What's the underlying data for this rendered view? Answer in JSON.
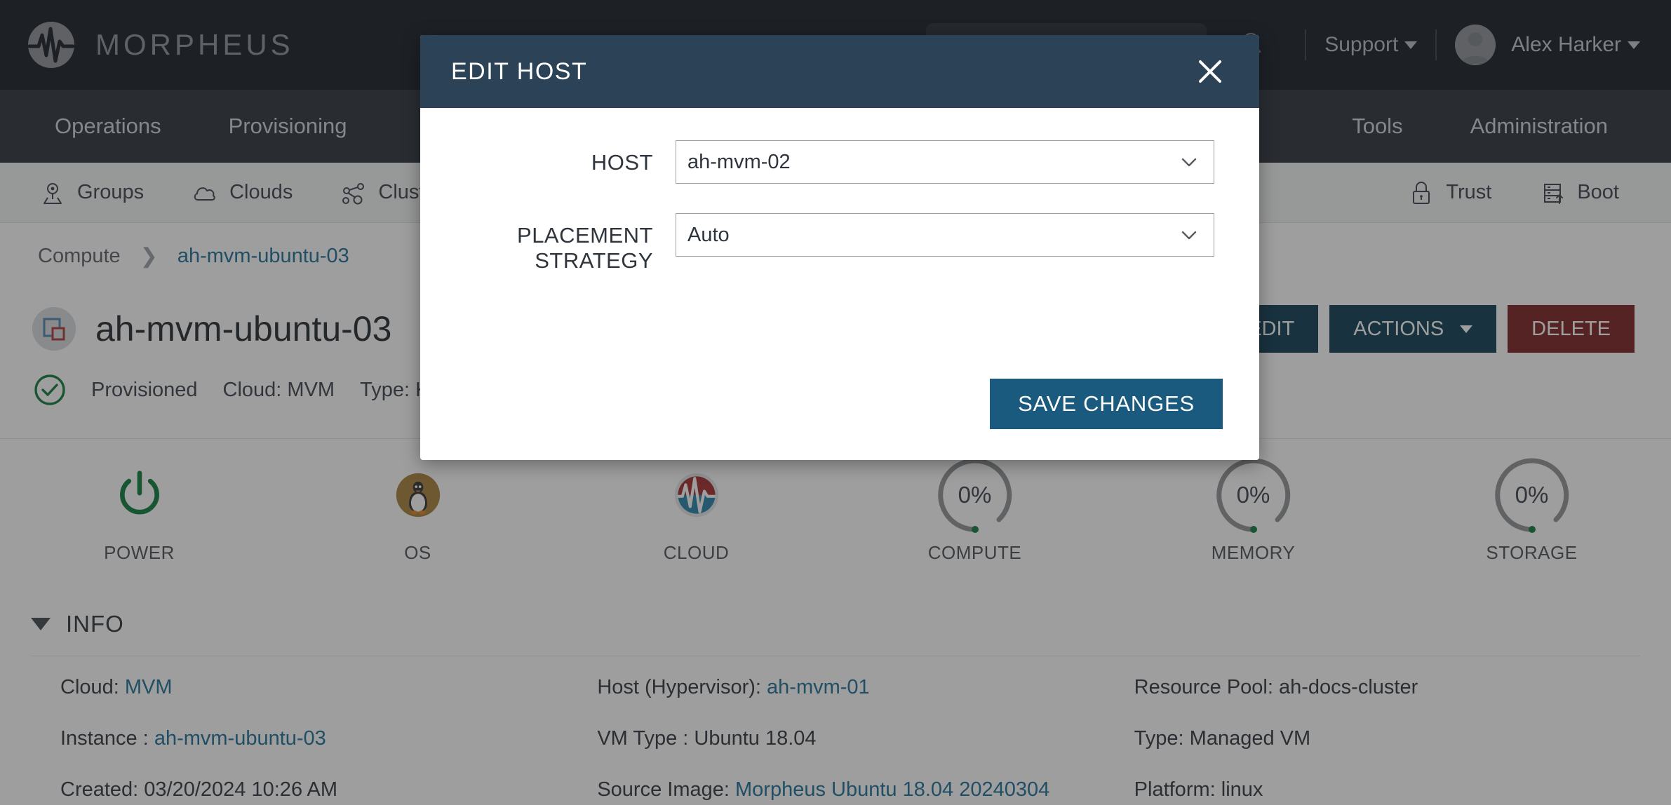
{
  "header": {
    "brand_name": "MORPHEUS",
    "logo_icon": "morpheus-waveform-logo",
    "search_placeholder": "",
    "search_icon": "search-icon",
    "bell_icon": "notification-bell-icon",
    "support_label": "Support",
    "user_name": "Alex Harker",
    "avatar_icon": "user-avatar"
  },
  "nav": {
    "items": [
      {
        "label": "Operations"
      },
      {
        "label": "Provisioning"
      },
      {
        "label": "Tools"
      },
      {
        "label": "Administration"
      }
    ]
  },
  "subnav": {
    "items": [
      {
        "label": "Groups",
        "icon": "map-pin-icon"
      },
      {
        "label": "Clouds",
        "icon": "cloud-icon"
      },
      {
        "label": "Clusters",
        "icon": "cluster-network-icon"
      },
      {
        "label": "Trust",
        "icon": "lock-icon"
      },
      {
        "label": "Boot",
        "icon": "server-boot-icon"
      }
    ]
  },
  "breadcrumb": {
    "root": "Compute",
    "separator": "❯",
    "current": "ah-mvm-ubuntu-03"
  },
  "page": {
    "title": "ah-mvm-ubuntu-03",
    "vm_icon": "virtual-machine-icon",
    "actions": {
      "edit_label": "EDIT",
      "actions_label": "ACTIONS",
      "delete_label": "DELETE"
    },
    "status": {
      "icon": "green-check-circle-icon",
      "state": "Provisioned",
      "cloud": "Cloud: MVM",
      "type": "Type: KVM"
    }
  },
  "tiles": [
    {
      "label": "POWER",
      "kind": "icon",
      "icon": "power-icon",
      "value": ""
    },
    {
      "label": "OS",
      "kind": "icon",
      "icon": "linux-penguin-icon",
      "value": ""
    },
    {
      "label": "CLOUD",
      "kind": "icon",
      "icon": "morpheus-cloud-icon",
      "value": ""
    },
    {
      "label": "COMPUTE",
      "kind": "gauge",
      "icon": "donut-gauge",
      "value": "0%"
    },
    {
      "label": "MEMORY",
      "kind": "gauge",
      "icon": "donut-gauge",
      "value": "0%"
    },
    {
      "label": "STORAGE",
      "kind": "gauge",
      "icon": "donut-gauge",
      "value": "0%"
    }
  ],
  "info": {
    "section_title": "INFO",
    "collapse_icon": "triangle-down-icon",
    "rows": [
      {
        "label": "Cloud:",
        "value": "MVM",
        "link": true
      },
      {
        "label": "Host (Hypervisor):",
        "value": "ah-mvm-01",
        "link": true
      },
      {
        "label": "Resource Pool:",
        "value": "ah-docs-cluster",
        "link": false
      },
      {
        "label": "Instance :",
        "value": "ah-mvm-ubuntu-03",
        "link": true
      },
      {
        "label": "VM Type :",
        "value": "Ubuntu 18.04",
        "link": false
      },
      {
        "label": "Type:",
        "value": "Managed VM",
        "link": false
      },
      {
        "label": "Created:",
        "value": "03/20/2024 10:26 AM",
        "link": false
      },
      {
        "label": "Source Image:",
        "value": "Morpheus Ubuntu 18.04 20240304",
        "link": true
      },
      {
        "label": "Platform:",
        "value": "linux",
        "link": false
      }
    ]
  },
  "modal": {
    "title": "EDIT HOST",
    "close_icon": "close-x-icon",
    "fields": [
      {
        "label": "HOST",
        "value": "ah-mvm-02",
        "icon": "chevron-down-icon"
      },
      {
        "label": "PLACEMENT STRATEGY",
        "value": "Auto",
        "icon": "chevron-down-icon"
      }
    ],
    "save_label": "SAVE CHANGES"
  },
  "colors": {
    "topbar_bg": "#141b23",
    "navbar_bg": "#2b323b",
    "modal_header_bg": "#2b4257",
    "save_button_bg": "#1a5a7f",
    "edit_button_bg": "#0d3b52",
    "delete_button_bg": "#7a2020",
    "link_blue": "#1a6e96",
    "status_green": "#0f7a3d",
    "os_tile_bg": "#a8803a"
  }
}
